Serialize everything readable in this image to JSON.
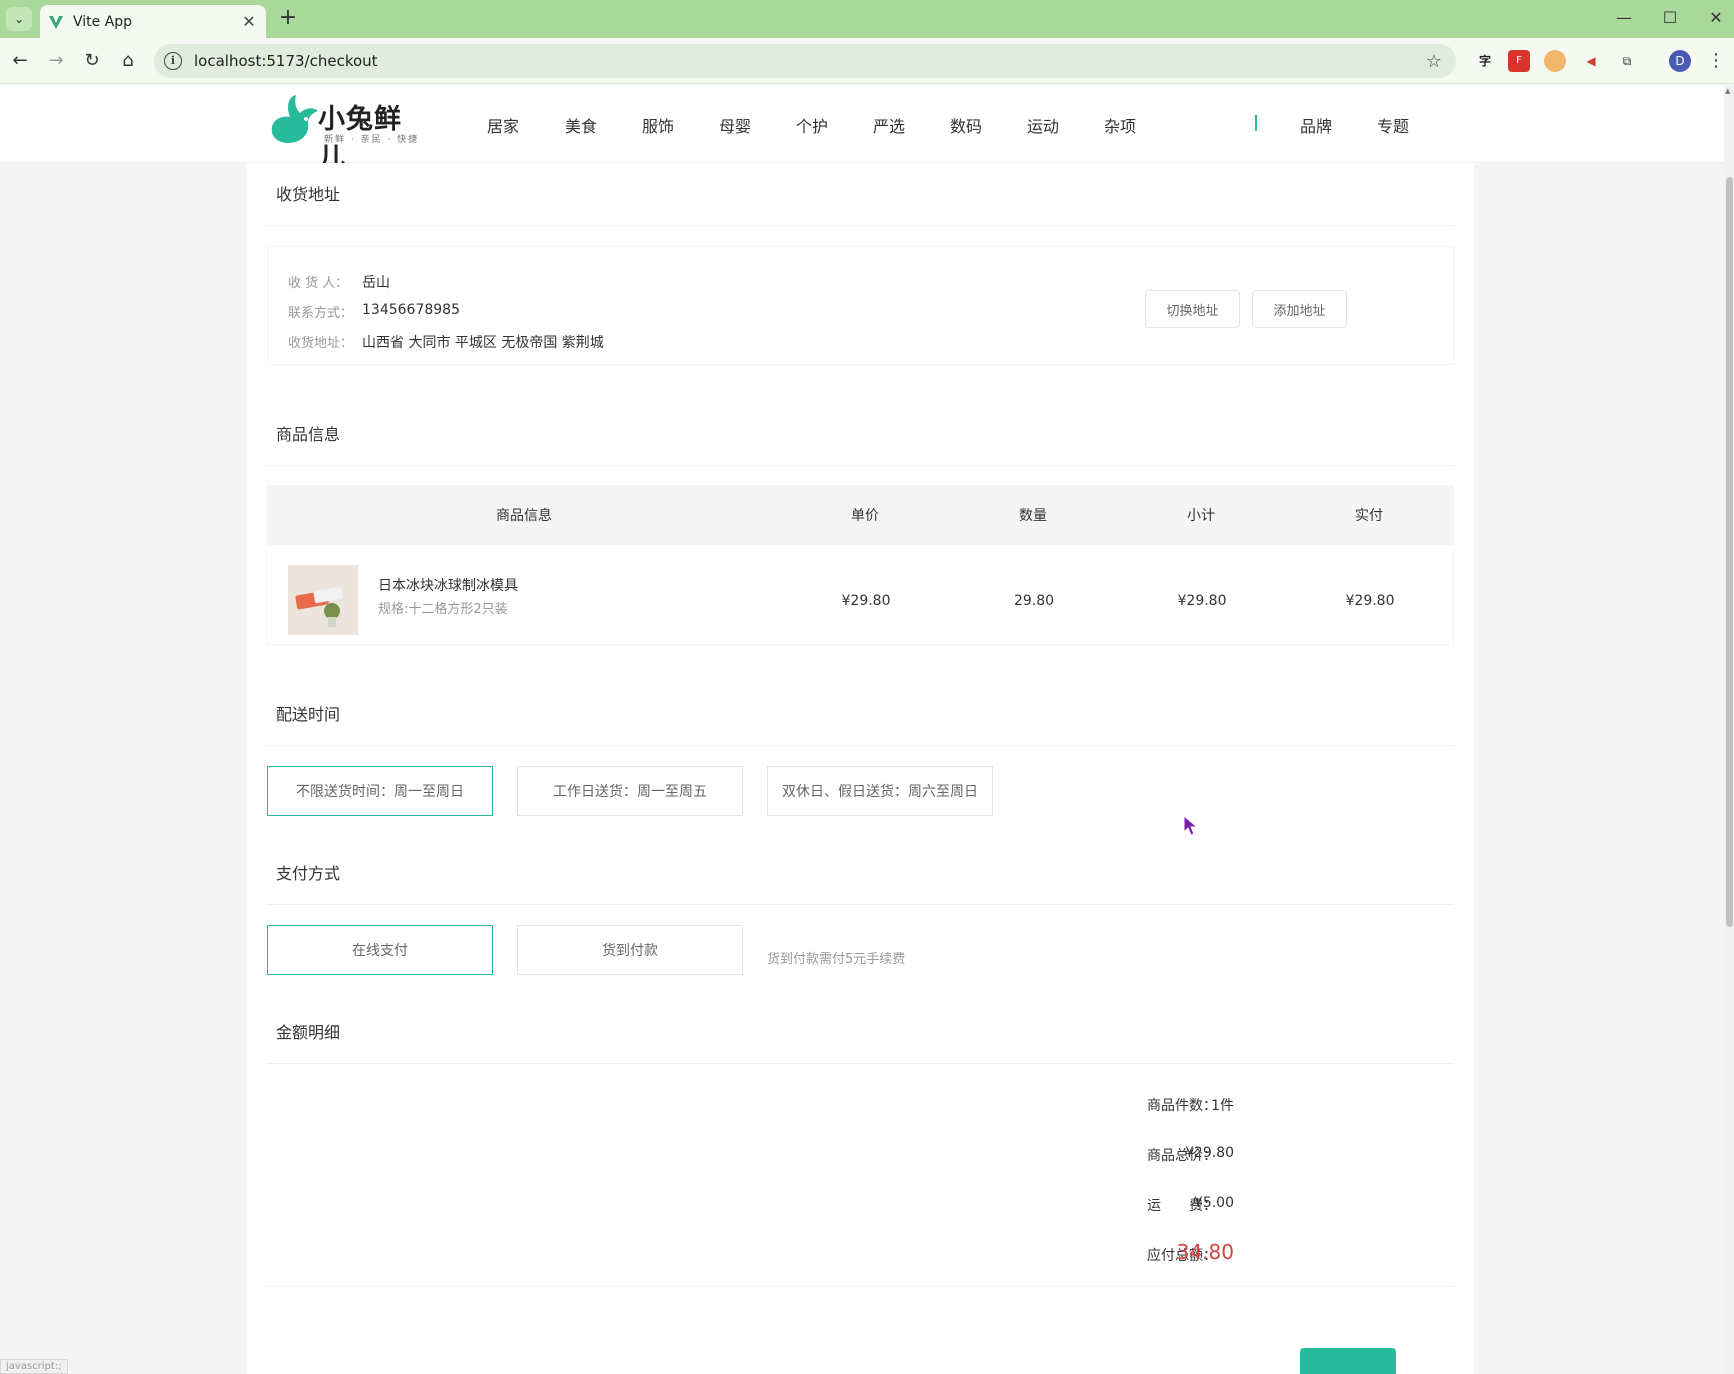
{
  "browser": {
    "tab_title": "Vite App",
    "url": "localhost:5173/checkout",
    "avatar_letter": "D",
    "status_text": "javascript:;"
  },
  "header": {
    "logo_text": "小兔鲜儿",
    "logo_sub": "新鲜 · 亲民 · 快捷",
    "nav": [
      "居家",
      "美食",
      "服饰",
      "母婴",
      "个护",
      "严选",
      "数码",
      "运动",
      "杂项"
    ],
    "nav_right": [
      "品牌",
      "专题"
    ]
  },
  "address": {
    "section_title": "收货地址",
    "receiver_label": "收 货 人：",
    "receiver": "岳山",
    "phone_label": "联系方式：",
    "phone": "13456678985",
    "addr_label": "收货地址：",
    "addr": "山西省 大同市 平城区 无极帝国 紫荆城",
    "switch_btn": "切换地址",
    "add_btn": "添加地址"
  },
  "goods": {
    "section_title": "商品信息",
    "columns": [
      "商品信息",
      "单价",
      "数量",
      "小计",
      "实付"
    ],
    "items": [
      {
        "name": "日本冰块冰球制冰模具",
        "spec": "规格:十二格方形2只装",
        "price": "¥29.80",
        "count": "29.80",
        "subtotal": "¥29.80",
        "paid": "¥29.80"
      }
    ]
  },
  "delivery": {
    "section_title": "配送时间",
    "options": [
      "不限送货时间：周一至周日",
      "工作日送货：周一至周五",
      "双休日、假日送货：周六至周日"
    ]
  },
  "payment": {
    "section_title": "支付方式",
    "options": [
      "在线支付",
      "货到付款"
    ],
    "note": "货到付款需付5元手续费"
  },
  "summary": {
    "section_title": "金额明细",
    "count_label": "商品件数：",
    "count": "1件",
    "total_label": "商品总价：",
    "total": "¥29.80",
    "freight_label": "运　　费：",
    "freight": "¥5.00",
    "pay_label": "应付总额：",
    "pay": "34.80"
  },
  "colors": {
    "accent": "#27ba9b",
    "price_red": "#cf4444",
    "chrome_green": "#a8d89a"
  }
}
